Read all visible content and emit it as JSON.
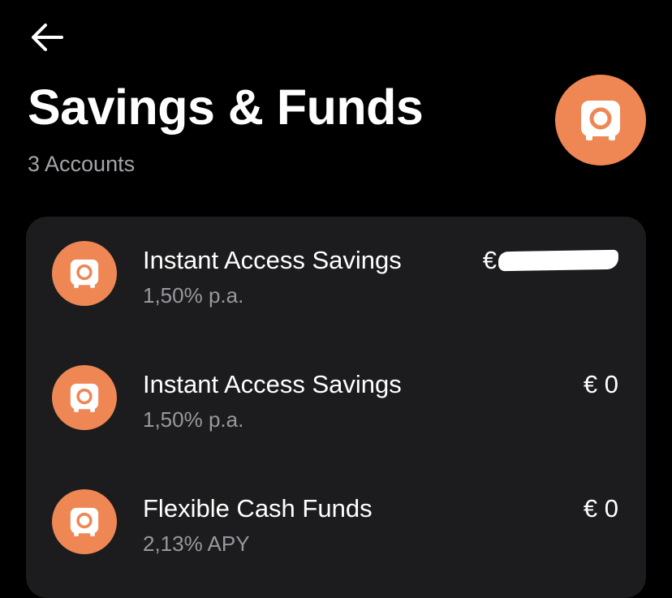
{
  "header": {
    "back_icon": "arrow-left-icon",
    "title": "Savings & Funds",
    "subtitle": "3 Accounts",
    "hero_icon": "safe-icon"
  },
  "colors": {
    "background": "#000000",
    "card": "#1c1c1e",
    "accent": "#ee8754",
    "secondary_text": "#98989d"
  },
  "accounts": [
    {
      "name": "Instant Access Savings",
      "rate": "1,50% p.a.",
      "amount": "€",
      "amount_redacted": true,
      "icon": "safe-icon"
    },
    {
      "name": "Instant Access Savings",
      "rate": "1,50% p.a.",
      "amount": "€ 0",
      "amount_redacted": false,
      "icon": "safe-icon"
    },
    {
      "name": "Flexible Cash Funds",
      "rate": "2,13% APY",
      "amount": "€ 0",
      "amount_redacted": false,
      "icon": "safe-icon"
    }
  ]
}
